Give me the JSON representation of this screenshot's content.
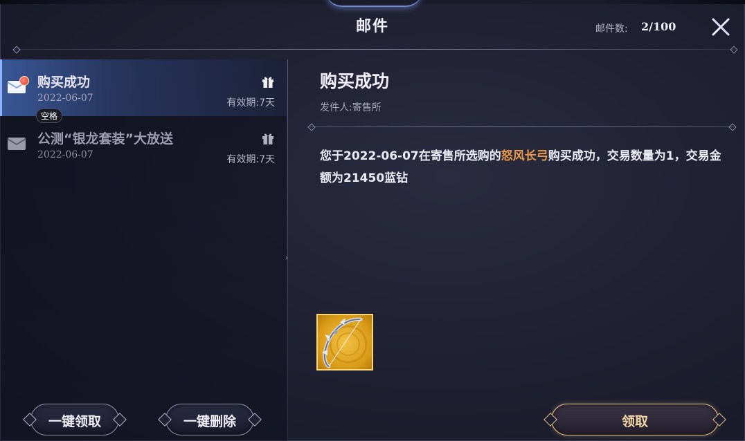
{
  "header": {
    "title": "邮件",
    "mail_count_label": "邮件数:",
    "mail_count_value": "2/100"
  },
  "mail_list": {
    "items": [
      {
        "subject": "购买成功",
        "date": "2022-06-07",
        "validity": "有效期:7天",
        "selected": true,
        "unread": true,
        "icon": "envelope-icon",
        "attachment_icon": "gift-icon"
      },
      {
        "subject": "公测“银龙套装”大放送",
        "date": "2022-06-07",
        "validity": "有效期:7天",
        "selected": false,
        "unread": false,
        "icon": "envelope-icon",
        "attachment_icon": "gift-icon"
      }
    ],
    "tooltip": "空格"
  },
  "detail": {
    "title": "购买成功",
    "sender": "发件人:寄售所",
    "body_prefix": "您于2022-06-07在寄售所选购的",
    "body_highlight": "怒风长弓",
    "body_suffix": "购买成功，交易数量为1，交易金额为21450蓝钻",
    "attachment": {
      "icon": "longbow-icon",
      "rarity_color": "#f2c244"
    }
  },
  "buttons": {
    "claim_all": "一键领取",
    "delete_all": "一键删除",
    "claim": "领取"
  },
  "colors": {
    "highlight": "#e89a4a",
    "gold_border": "#e2c28b",
    "selected_row": "#466ebe"
  }
}
